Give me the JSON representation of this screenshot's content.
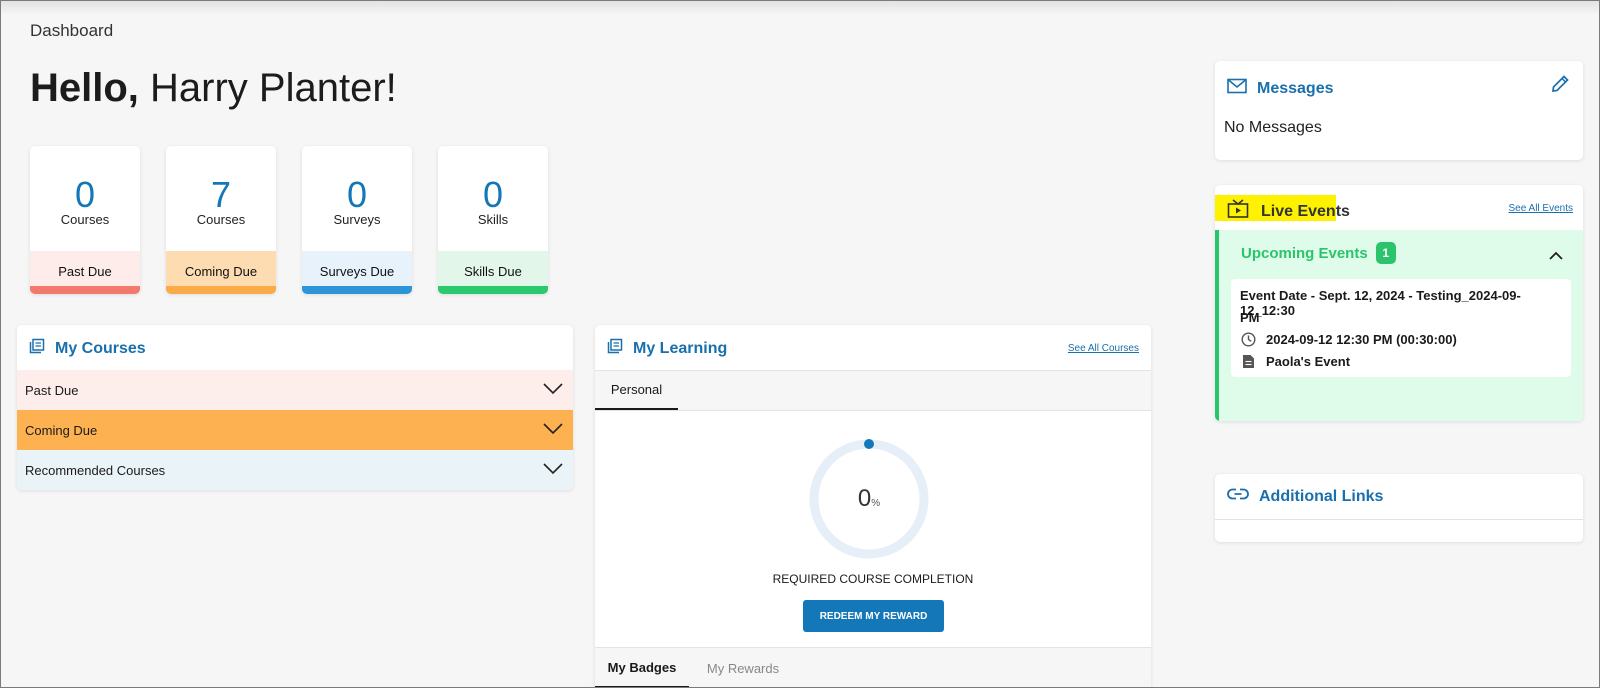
{
  "breadcrumb": "Dashboard",
  "greeting": {
    "hello": "Hello,",
    "name": "Harry Planter!"
  },
  "stats": [
    {
      "value": "0",
      "type": "Courses",
      "footer": "Past Due",
      "color": "#f27a6c",
      "bg": "#fdecea"
    },
    {
      "value": "7",
      "type": "Courses",
      "footer": "Coming Due",
      "color": "#fbaa48",
      "bg": "#fddcb1"
    },
    {
      "value": "0",
      "type": "Surveys",
      "footer": "Surveys Due",
      "color": "#2d94d8",
      "bg": "#e7f2fa"
    },
    {
      "value": "0",
      "type": "Skills",
      "footer": "Skills Due",
      "color": "#2ac96e",
      "bg": "#e2f6ea"
    }
  ],
  "my_courses": {
    "title": "My Courses",
    "icon": "courses-icon",
    "rows": [
      {
        "label": "Past Due",
        "bg": "#fdeeec"
      },
      {
        "label": "Coming Due",
        "bg": "#fdb150"
      },
      {
        "label": "Recommended Courses",
        "bg": "#eaf4f8"
      }
    ]
  },
  "my_learning": {
    "title": "My Learning",
    "see_all": "See All Courses",
    "tab": "Personal",
    "progress_value": "0",
    "progress_unit": "%",
    "progress_fraction": 0,
    "completion_label": "REQUIRED COURSE COMPLETION",
    "redeem_label": "REDEEM MY REWARD",
    "bottom_tabs": [
      "My Badges",
      "My Rewards"
    ]
  },
  "messages": {
    "title": "Messages",
    "empty": "No Messages"
  },
  "live_events": {
    "title": "Live Events",
    "see_all": "See All Events",
    "upcoming_label": "Upcoming Events",
    "upcoming_count": "1",
    "event": {
      "line1": "Event Date - Sept. 12, 2024 - Testing_2024-09-12_12:30",
      "line2": "PM",
      "time": "2024-09-12 12:30 PM (00:30:00)",
      "name": "Paola's Event"
    }
  },
  "additional_links": {
    "title": "Additional Links"
  },
  "colors": {
    "accent": "#1478b8",
    "highlight": "#fff200",
    "green": "#2bc46d",
    "events_bg": "#dffcea"
  }
}
